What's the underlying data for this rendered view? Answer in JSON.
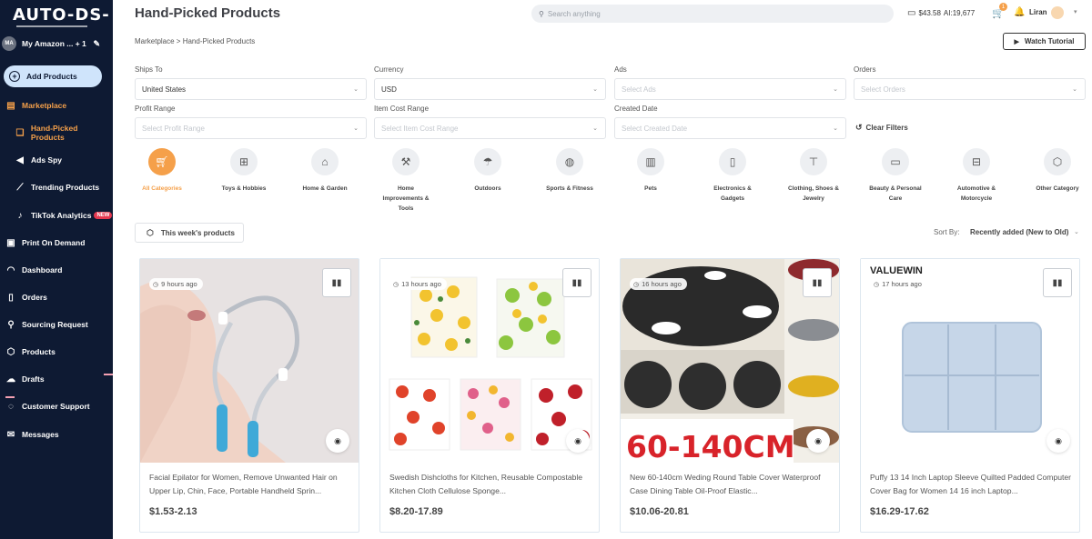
{
  "logo": "AUTO-DS-",
  "store": {
    "avatar": "MA",
    "name": "My Amazon ... + 1"
  },
  "sidebar": {
    "add_products": "Add Products",
    "items": [
      {
        "label": "Marketplace",
        "icon": "store-icon"
      },
      {
        "label": "Hand-Picked Products",
        "icon": "gift-icon"
      },
      {
        "label": "Ads Spy",
        "icon": "megaphone-icon"
      },
      {
        "label": "Trending Products",
        "icon": "trend-icon"
      },
      {
        "label": "TikTok Analytics",
        "icon": "tiktok-icon",
        "badge": "NEW"
      },
      {
        "label": "Print On Demand",
        "icon": "print-icon"
      },
      {
        "label": "Dashboard",
        "icon": "dashboard-icon"
      },
      {
        "label": "Orders",
        "icon": "orders-icon"
      },
      {
        "label": "Sourcing Request",
        "icon": "sourcing-icon"
      },
      {
        "label": "Products",
        "icon": "box-icon"
      },
      {
        "label": "Drafts",
        "icon": "drafts-icon"
      },
      {
        "label": "Customer Support",
        "icon": "support-icon"
      },
      {
        "label": "Messages",
        "icon": "mail-icon"
      }
    ]
  },
  "header": {
    "title": "Hand-Picked Products",
    "search_placeholder": "Search anything",
    "balance": "$43.58",
    "ai_credits": "AI:19,677",
    "cart_count": "1",
    "user": "Liran"
  },
  "breadcrumb": "Marketplace > Hand-Picked Products",
  "watch_tutorial": "Watch Tutorial",
  "filters": {
    "ships_to": {
      "label": "Ships To",
      "value": "United States"
    },
    "currency": {
      "label": "Currency",
      "value": "USD"
    },
    "ads": {
      "label": "Ads",
      "placeholder": "Select Ads"
    },
    "orders": {
      "label": "Orders",
      "placeholder": "Select Orders"
    },
    "profit_range": {
      "label": "Profit Range",
      "placeholder": "Select Profit Range"
    },
    "item_cost": {
      "label": "Item Cost Range",
      "placeholder": "Select Item Cost Range"
    },
    "created_date": {
      "label": "Created Date",
      "placeholder": "Select Created Date"
    },
    "clear": "Clear Filters"
  },
  "categories": [
    {
      "label": "All Categories",
      "icon": "cart-icon"
    },
    {
      "label": "Toys & Hobbies",
      "icon": "gamepad-icon"
    },
    {
      "label": "Home & Garden",
      "icon": "home-icon"
    },
    {
      "label": "Home Improvements & Tools",
      "icon": "tools-icon"
    },
    {
      "label": "Outdoors",
      "icon": "umbrella-icon"
    },
    {
      "label": "Sports & Fitness",
      "icon": "ball-icon"
    },
    {
      "label": "Pets",
      "icon": "pet-food-icon"
    },
    {
      "label": "Electronics & Gadgets",
      "icon": "phone-icon"
    },
    {
      "label": "Clothing, Shoes & Jewelry",
      "icon": "shirt-icon"
    },
    {
      "label": "Beauty & Personal Care",
      "icon": "beauty-icon"
    },
    {
      "label": "Automotive & Motorcycle",
      "icon": "car-icon"
    },
    {
      "label": "Other Category",
      "icon": "cube-icon"
    }
  ],
  "week_button": "This week's products",
  "sort": {
    "label": "Sort By:",
    "value": "Recently added (New to Old)"
  },
  "products": [
    {
      "time": "9 hours ago",
      "title": "Facial Epilator for Women, Remove Unwanted Hair on Upper Lip, Chin, Face, Portable Handheld Sprin...",
      "price": "$1.53-2.13"
    },
    {
      "time": "13 hours ago",
      "title": "Swedish Dishcloths for Kitchen, Reusable Compostable Kitchen Cloth Cellulose Sponge...",
      "price": "$8.20-17.89"
    },
    {
      "time": "16 hours ago",
      "title": "New 60-140cm Weding Round Table Cover Waterproof Case Dining Table Oil-Proof Elastic...",
      "price": "$10.06-20.81",
      "image_text": "60-140CM"
    },
    {
      "time": "17 hours ago",
      "title": "Puffy 13 14 Inch Laptop Sleeve Quilted Padded Computer Cover Bag for Women 14 16 inch Laptop...",
      "price": "$16.29-17.62",
      "image_text": "VALUEWIN"
    }
  ],
  "colors": {
    "sidebar": "#0e1a33",
    "accent": "#f5a04a",
    "add_button": "#cfe4fb"
  }
}
